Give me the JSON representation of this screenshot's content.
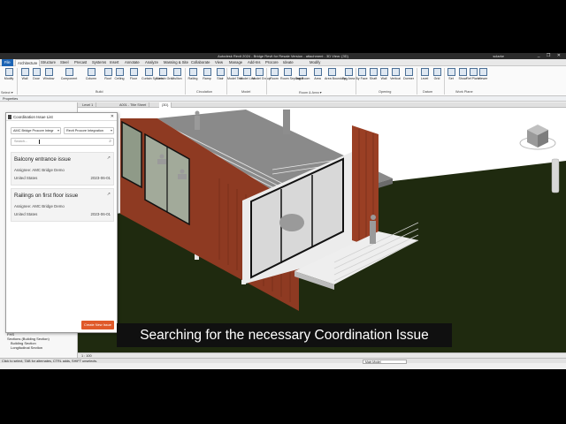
{
  "window": {
    "title": "Autodesk Revit 2024 - Bridge Revit for Resale Version - attachment - 3D View: {3D}",
    "user": "sclarke",
    "window_buttons": "_ ❐ ✕"
  },
  "ribbon": {
    "file_tab": "File",
    "tabs": [
      "Architecture",
      "Structure",
      "Steel",
      "Precast",
      "Systems",
      "Insert",
      "Annotate",
      "Analyze",
      "Massing & Site",
      "Collaborate",
      "View",
      "Manage",
      "Add-Ins",
      "Procore",
      "Ideate",
      "Modify"
    ],
    "tools": [
      "Modify",
      "Wall",
      "Door",
      "Window",
      "Component",
      "Column",
      "Roof",
      "Ceiling",
      "Floor",
      "Curtain System",
      "Curtain Grid",
      "Mullion",
      "Railing",
      "Ramp",
      "Stair",
      "Model Text",
      "Model Line",
      "Model Group",
      "Room",
      "Room Separator",
      "Tag Room",
      "Area",
      "Area Boundary",
      "Tag Area",
      "By Face",
      "Shaft",
      "Wall",
      "Vertical",
      "Dormer",
      "Level",
      "Grid",
      "Set",
      "Show",
      "Ref Plane",
      "Viewer"
    ],
    "groups": [
      "Select ▾",
      "Build",
      "Circulation",
      "Model",
      "Room & Area ▾",
      "Opening",
      "Datum",
      "Work Plane"
    ]
  },
  "properties": {
    "header": "Properties"
  },
  "view_tabs": [
    "Level 1",
    "A001 - Title Sheet",
    "{3D}"
  ],
  "project_browser": {
    "items": [
      "FHS",
      "Sections (Building Section)",
      "Building Section",
      "Longitudinal Section"
    ]
  },
  "view_control": {
    "scale": "1 : 100"
  },
  "status": {
    "text": "Click to select, TAB for alternates, CTRL adds, SHIFT unselects.",
    "model": "Main Model"
  },
  "coordination_panel": {
    "title": "Coordination Issue List",
    "close_glyph": "✕",
    "project_select": "AMC Bridge Procore Integr",
    "integration_select": "Revit Procore Integration",
    "search_placeholder": "Search...",
    "issues": [
      {
        "title": "Balcony entrance issue",
        "assignee": "Assignee: AMC Bridge Demo",
        "location": "United States",
        "date": "2023-06-01"
      },
      {
        "title": "Railings on first floor issue",
        "assignee": "Assignee: AMC Bridge Demo",
        "location": "United States",
        "date": "2023-06-01"
      }
    ],
    "create_button": "Create New Issue"
  },
  "caption": "Searching for the necessary Coordination Issue",
  "colors": {
    "accent": "#e0592a",
    "file_tab": "#1c64b4",
    "cladding": "#9a3f24"
  }
}
